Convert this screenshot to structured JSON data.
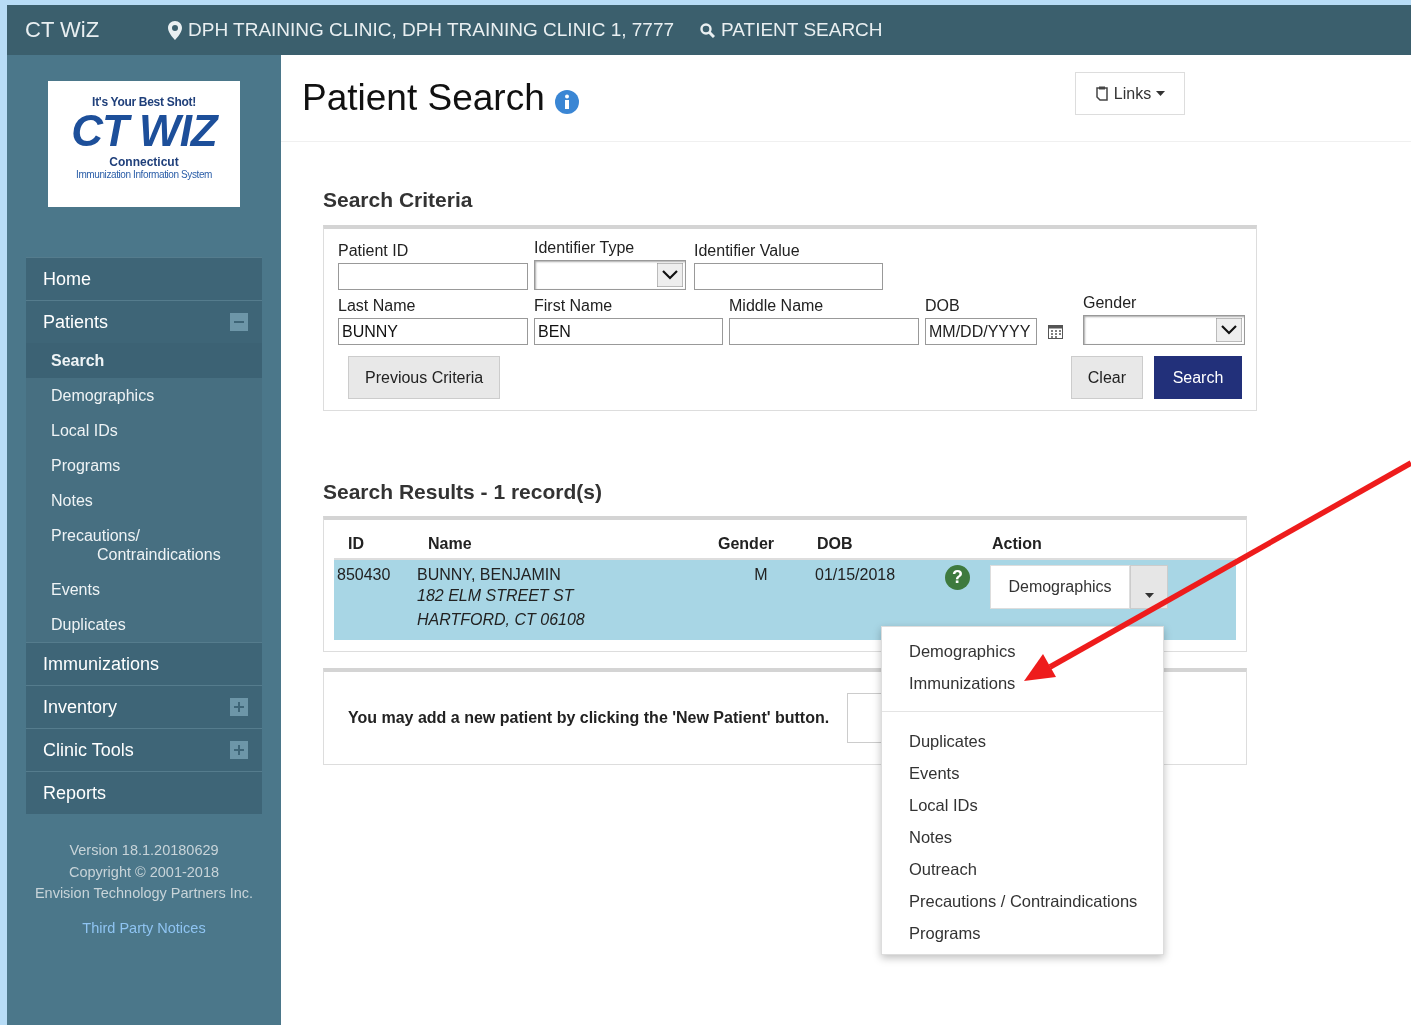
{
  "header": {
    "app_name": "CT WiZ",
    "location": "DPH TRAINING CLINIC, DPH TRAINING CLINIC 1, 7777",
    "page": "PATIENT SEARCH"
  },
  "logo": {
    "tagline": "It's Your Best Shot!",
    "title": "CT WIZ",
    "state": "Connecticut",
    "subtitle": "Immunization Information System"
  },
  "nav": [
    {
      "label": "Home",
      "kind": "link"
    },
    {
      "label": "Patients",
      "kind": "group",
      "expanded": true,
      "children": [
        {
          "label": "Search",
          "selected": true
        },
        {
          "label": "Demographics",
          "selected": false
        },
        {
          "label": "Local IDs",
          "selected": false
        },
        {
          "label": "Programs",
          "selected": false
        },
        {
          "label": "Notes",
          "selected": false
        },
        {
          "label": "Precautions/ Contraindications",
          "selected": false
        },
        {
          "label": "Events",
          "selected": false
        },
        {
          "label": "Duplicates",
          "selected": false
        }
      ]
    },
    {
      "label": "Immunizations",
      "kind": "link"
    },
    {
      "label": "Inventory",
      "kind": "group",
      "expanded": false
    },
    {
      "label": "Clinic Tools",
      "kind": "group",
      "expanded": false
    },
    {
      "label": "Reports",
      "kind": "link"
    }
  ],
  "footer": {
    "version": "Version 18.1.20180629",
    "copyright": "Copyright © 2001-2018",
    "company": "Envision Technology Partners Inc.",
    "link": "Third Party Notices"
  },
  "page": {
    "title": "Patient Search",
    "links_button": "Links"
  },
  "criteria": {
    "heading": "Search Criteria",
    "rows": [
      [
        {
          "label": "Patient ID",
          "kind": "text"
        },
        {
          "label": "Identifier Type",
          "kind": "select"
        },
        {
          "label": "Identifier Value",
          "kind": "text"
        }
      ],
      [
        {
          "label": "Last Name",
          "kind": "text",
          "value": "BUNNY"
        },
        {
          "label": "First Name",
          "kind": "text",
          "value": "BEN"
        },
        {
          "label": "Middle Name",
          "kind": "text"
        },
        {
          "label": "DOB",
          "kind": "date",
          "placeholder": "MM/DD/YYYY"
        },
        {
          "label": "Gender",
          "kind": "select"
        }
      ]
    ],
    "previous_button": "Previous Criteria",
    "clear_button": "Clear",
    "search_button": "Search"
  },
  "results": {
    "heading": "Search Results - 1 record(s)",
    "columns": [
      "ID",
      "Name",
      "Gender",
      "DOB",
      "Action"
    ],
    "rows": [
      {
        "id": "850430",
        "name": "BUNNY, BENJAMIN",
        "address_1": "182 ELM STREET ST",
        "address_2": "HARTFORD, CT 06108",
        "gender": "M",
        "dob": "01/15/2018",
        "help": "?",
        "action": "Demographics",
        "selected": true
      }
    ]
  },
  "action_menu": {
    "groups": [
      {
        "items": [
          "Demographics",
          "Immunizations"
        ]
      },
      {
        "items": [
          "Duplicates",
          "Events",
          "Local IDs",
          "Notes",
          "Outreach",
          "Precautions / Contraindications",
          "Programs"
        ]
      }
    ]
  },
  "new_patient": {
    "message": "You may add a new patient by clicking the 'New Patient' button."
  },
  "annotations": [
    {
      "kind": "arrow"
    }
  ]
}
